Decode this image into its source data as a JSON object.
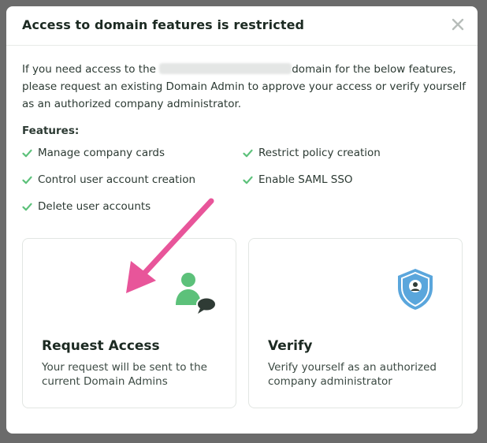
{
  "dialog": {
    "title": "Access to domain features is restricted",
    "desc_before": "If you need access to the",
    "desc_after": "domain for the below features, please request an existing Domain Admin to approve your access or verify yourself as an authorized company administrator."
  },
  "features": {
    "label": "Features:",
    "items": [
      "Manage company cards",
      "Restrict policy creation",
      "Control user account creation",
      "Enable SAML SSO",
      "Delete user accounts"
    ]
  },
  "cards": {
    "request": {
      "title": "Request Access",
      "desc": "Your request will be sent to the current Domain Admins"
    },
    "verify": {
      "title": "Verify",
      "desc": "Verify yourself as an authorized company administrator"
    }
  },
  "icons": {
    "close": "close-icon",
    "check": "check-icon",
    "person_chat": "person-chat-icon",
    "shield": "shield-user-icon",
    "arrow": "annotation-arrow"
  },
  "colors": {
    "accent_green": "#5cc17a",
    "annotation_pink": "#e8559a",
    "shield_blue": "#5aa6dc"
  }
}
